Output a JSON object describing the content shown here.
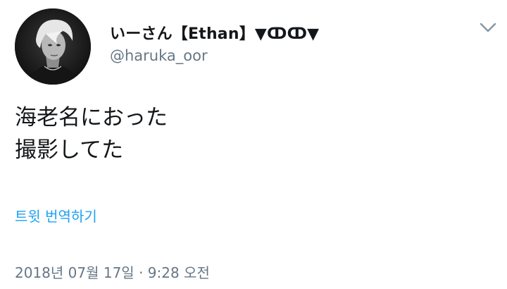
{
  "tweet": {
    "author": {
      "display_name": "いーさん【Ethan】▼ↀↀ▼",
      "handle": "@haruka_oor",
      "avatar_icon": "profile-photo"
    },
    "menu_icon": "chevron-down-icon",
    "text_lines": [
      "海老名におった",
      "撮影してた"
    ],
    "translate_label": "트윗 번역하기",
    "timestamp": "2018년 07월 17일 · 9:28 오전"
  },
  "colors": {
    "text": "#14171a",
    "secondary": "#657786",
    "link": "#1da1f2",
    "background": "#ffffff"
  }
}
